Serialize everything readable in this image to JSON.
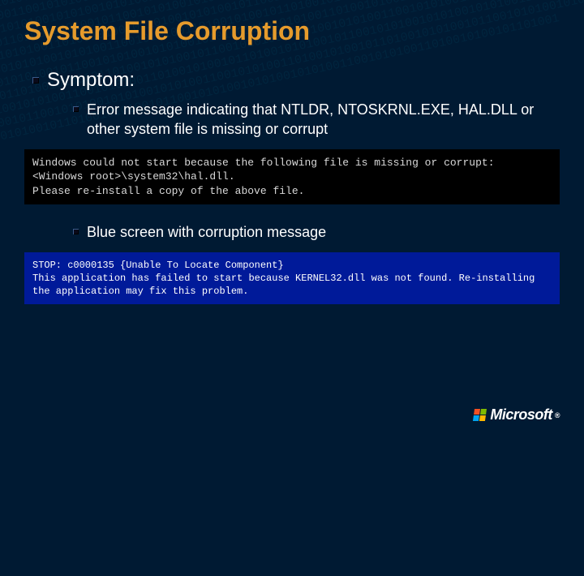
{
  "title": "System File Corruption",
  "symptom_label": "Symptom:",
  "bullet1": "Error message indicating that NTLDR, NTOSKRNL.EXE, HAL.DLL or other system file is missing or corrupt",
  "console_black": "Windows could not start because the following file is missing or corrupt:\n<Windows root>\\system32\\hal.dll.\nPlease re-install a copy of the above file.",
  "bullet2": "Blue screen with corruption message",
  "console_blue": "STOP: c0000135 {Unable To Locate Component}\nThis application has failed to start because KERNEL32.dll was not found. Re-installing the application may fix this problem.",
  "brand": "Microsoft",
  "bg_bits": "010101001010100110010101001101001010010110100101010010110010101001010100101010011001010100110100101001011010010101001011001010100101010010101001100101010011010010100101101001010100101100101010010101001010100110010101001101001010010110100101010010110010101001010100101010011001010100110100101001011010010101001011001010100101010010101001100101010011010010100101101001010100101100101010010101001010100110010101001101001010010110100101010010110010101001010100101010011001010100110100101001011010010101001011001010100101010010101001100101010011010010100101101001010100101100101010010101001010100110010101001101001010010110100101010010110010101001010100101010011001010100110100101001011010010101001011001010100101010010101001100101010011010010100101101001010100101100101010010101001010100110010101001101001010010110100101010010110010101001010100101010011001010100110100101001011010010101001011001010100101010010101001100101010011010010100101101001010100101100101010010101001010100110010101001101001010010110100101010010110010101001010100101010011001010100110100101001011010010101001011001010100101010010101001100101010011010010100101101001010100101100101010010101001010100110010101001101001010010110100101010010110010101001010100101010011001010100110100101001011010010101001011001010100101010010101001100101010011010010100101101001010100101100101010010101001010100110010101001101001010010110100101010010110010101001010100101010011001010100110100101001011010010101001011001010100101010010101001100101010011010010100101101001"
}
